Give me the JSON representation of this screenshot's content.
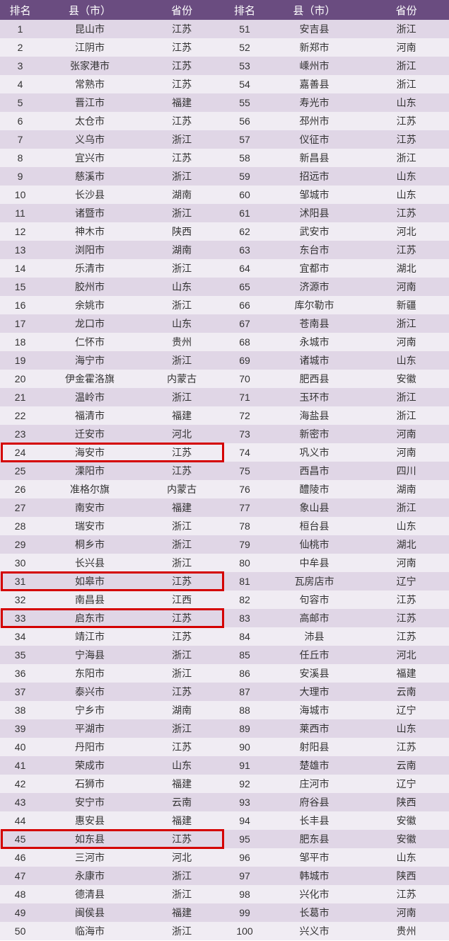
{
  "headers": {
    "rank": "排名",
    "county": "县（市）",
    "province": "省份"
  },
  "highlight_ranks": [
    24,
    31,
    33,
    45
  ],
  "rows": [
    {
      "rank": 1,
      "county": "昆山市",
      "province": "江苏"
    },
    {
      "rank": 2,
      "county": "江阴市",
      "province": "江苏"
    },
    {
      "rank": 3,
      "county": "张家港市",
      "province": "江苏"
    },
    {
      "rank": 4,
      "county": "常熟市",
      "province": "江苏"
    },
    {
      "rank": 5,
      "county": "晋江市",
      "province": "福建"
    },
    {
      "rank": 6,
      "county": "太仓市",
      "province": "江苏"
    },
    {
      "rank": 7,
      "county": "义乌市",
      "province": "浙江"
    },
    {
      "rank": 8,
      "county": "宜兴市",
      "province": "江苏"
    },
    {
      "rank": 9,
      "county": "慈溪市",
      "province": "浙江"
    },
    {
      "rank": 10,
      "county": "长沙县",
      "province": "湖南"
    },
    {
      "rank": 11,
      "county": "诸暨市",
      "province": "浙江"
    },
    {
      "rank": 12,
      "county": "神木市",
      "province": "陕西"
    },
    {
      "rank": 13,
      "county": "浏阳市",
      "province": "湖南"
    },
    {
      "rank": 14,
      "county": "乐清市",
      "province": "浙江"
    },
    {
      "rank": 15,
      "county": "胶州市",
      "province": "山东"
    },
    {
      "rank": 16,
      "county": "余姚市",
      "province": "浙江"
    },
    {
      "rank": 17,
      "county": "龙口市",
      "province": "山东"
    },
    {
      "rank": 18,
      "county": "仁怀市",
      "province": "贵州"
    },
    {
      "rank": 19,
      "county": "海宁市",
      "province": "浙江"
    },
    {
      "rank": 20,
      "county": "伊金霍洛旗",
      "province": "内蒙古"
    },
    {
      "rank": 21,
      "county": "温岭市",
      "province": "浙江"
    },
    {
      "rank": 22,
      "county": "福清市",
      "province": "福建"
    },
    {
      "rank": 23,
      "county": "迁安市",
      "province": "河北"
    },
    {
      "rank": 24,
      "county": "海安市",
      "province": "江苏"
    },
    {
      "rank": 25,
      "county": "溧阳市",
      "province": "江苏"
    },
    {
      "rank": 26,
      "county": "准格尔旗",
      "province": "内蒙古"
    },
    {
      "rank": 27,
      "county": "南安市",
      "province": "福建"
    },
    {
      "rank": 28,
      "county": "瑞安市",
      "province": "浙江"
    },
    {
      "rank": 29,
      "county": "桐乡市",
      "province": "浙江"
    },
    {
      "rank": 30,
      "county": "长兴县",
      "province": "浙江"
    },
    {
      "rank": 31,
      "county": "如皋市",
      "province": "江苏"
    },
    {
      "rank": 32,
      "county": "南昌县",
      "province": "江西"
    },
    {
      "rank": 33,
      "county": "启东市",
      "province": "江苏"
    },
    {
      "rank": 34,
      "county": "靖江市",
      "province": "江苏"
    },
    {
      "rank": 35,
      "county": "宁海县",
      "province": "浙江"
    },
    {
      "rank": 36,
      "county": "东阳市",
      "province": "浙江"
    },
    {
      "rank": 37,
      "county": "泰兴市",
      "province": "江苏"
    },
    {
      "rank": 38,
      "county": "宁乡市",
      "province": "湖南"
    },
    {
      "rank": 39,
      "county": "平湖市",
      "province": "浙江"
    },
    {
      "rank": 40,
      "county": "丹阳市",
      "province": "江苏"
    },
    {
      "rank": 41,
      "county": "荣成市",
      "province": "山东"
    },
    {
      "rank": 42,
      "county": "石狮市",
      "province": "福建"
    },
    {
      "rank": 43,
      "county": "安宁市",
      "province": "云南"
    },
    {
      "rank": 44,
      "county": "惠安县",
      "province": "福建"
    },
    {
      "rank": 45,
      "county": "如东县",
      "province": "江苏"
    },
    {
      "rank": 46,
      "county": "三河市",
      "province": "河北"
    },
    {
      "rank": 47,
      "county": "永康市",
      "province": "浙江"
    },
    {
      "rank": 48,
      "county": "德清县",
      "province": "浙江"
    },
    {
      "rank": 49,
      "county": "闽侯县",
      "province": "福建"
    },
    {
      "rank": 50,
      "county": "临海市",
      "province": "浙江"
    },
    {
      "rank": 51,
      "county": "安吉县",
      "province": "浙江"
    },
    {
      "rank": 52,
      "county": "新郑市",
      "province": "河南"
    },
    {
      "rank": 53,
      "county": "嵊州市",
      "province": "浙江"
    },
    {
      "rank": 54,
      "county": "嘉善县",
      "province": "浙江"
    },
    {
      "rank": 55,
      "county": "寿光市",
      "province": "山东"
    },
    {
      "rank": 56,
      "county": "邳州市",
      "province": "江苏"
    },
    {
      "rank": 57,
      "county": "仪征市",
      "province": "江苏"
    },
    {
      "rank": 58,
      "county": "新昌县",
      "province": "浙江"
    },
    {
      "rank": 59,
      "county": "招远市",
      "province": "山东"
    },
    {
      "rank": 60,
      "county": "邹城市",
      "province": "山东"
    },
    {
      "rank": 61,
      "county": "沭阳县",
      "province": "江苏"
    },
    {
      "rank": 62,
      "county": "武安市",
      "province": "河北"
    },
    {
      "rank": 63,
      "county": "东台市",
      "province": "江苏"
    },
    {
      "rank": 64,
      "county": "宜都市",
      "province": "湖北"
    },
    {
      "rank": 65,
      "county": "济源市",
      "province": "河南"
    },
    {
      "rank": 66,
      "county": "库尔勒市",
      "province": "新疆"
    },
    {
      "rank": 67,
      "county": "苍南县",
      "province": "浙江"
    },
    {
      "rank": 68,
      "county": "永城市",
      "province": "河南"
    },
    {
      "rank": 69,
      "county": "诸城市",
      "province": "山东"
    },
    {
      "rank": 70,
      "county": "肥西县",
      "province": "安徽"
    },
    {
      "rank": 71,
      "county": "玉环市",
      "province": "浙江"
    },
    {
      "rank": 72,
      "county": "海盐县",
      "province": "浙江"
    },
    {
      "rank": 73,
      "county": "新密市",
      "province": "河南"
    },
    {
      "rank": 74,
      "county": "巩义市",
      "province": "河南"
    },
    {
      "rank": 75,
      "county": "西昌市",
      "province": "四川"
    },
    {
      "rank": 76,
      "county": "醴陵市",
      "province": "湖南"
    },
    {
      "rank": 77,
      "county": "象山县",
      "province": "浙江"
    },
    {
      "rank": 78,
      "county": "桓台县",
      "province": "山东"
    },
    {
      "rank": 79,
      "county": "仙桃市",
      "province": "湖北"
    },
    {
      "rank": 80,
      "county": "中牟县",
      "province": "河南"
    },
    {
      "rank": 81,
      "county": "瓦房店市",
      "province": "辽宁"
    },
    {
      "rank": 82,
      "county": "句容市",
      "province": "江苏"
    },
    {
      "rank": 83,
      "county": "高邮市",
      "province": "江苏"
    },
    {
      "rank": 84,
      "county": "沛县",
      "province": "江苏"
    },
    {
      "rank": 85,
      "county": "任丘市",
      "province": "河北"
    },
    {
      "rank": 86,
      "county": "安溪县",
      "province": "福建"
    },
    {
      "rank": 87,
      "county": "大理市",
      "province": "云南"
    },
    {
      "rank": 88,
      "county": "海城市",
      "province": "辽宁"
    },
    {
      "rank": 89,
      "county": "莱西市",
      "province": "山东"
    },
    {
      "rank": 90,
      "county": "射阳县",
      "province": "江苏"
    },
    {
      "rank": 91,
      "county": "楚雄市",
      "province": "云南"
    },
    {
      "rank": 92,
      "county": "庄河市",
      "province": "辽宁"
    },
    {
      "rank": 93,
      "county": "府谷县",
      "province": "陕西"
    },
    {
      "rank": 94,
      "county": "长丰县",
      "province": "安徽"
    },
    {
      "rank": 95,
      "county": "肥东县",
      "province": "安徽"
    },
    {
      "rank": 96,
      "county": "邹平市",
      "province": "山东"
    },
    {
      "rank": 97,
      "county": "韩城市",
      "province": "陕西"
    },
    {
      "rank": 98,
      "county": "兴化市",
      "province": "江苏"
    },
    {
      "rank": 99,
      "county": "长葛市",
      "province": "河南"
    },
    {
      "rank": 100,
      "county": "兴义市",
      "province": "贵州"
    }
  ]
}
